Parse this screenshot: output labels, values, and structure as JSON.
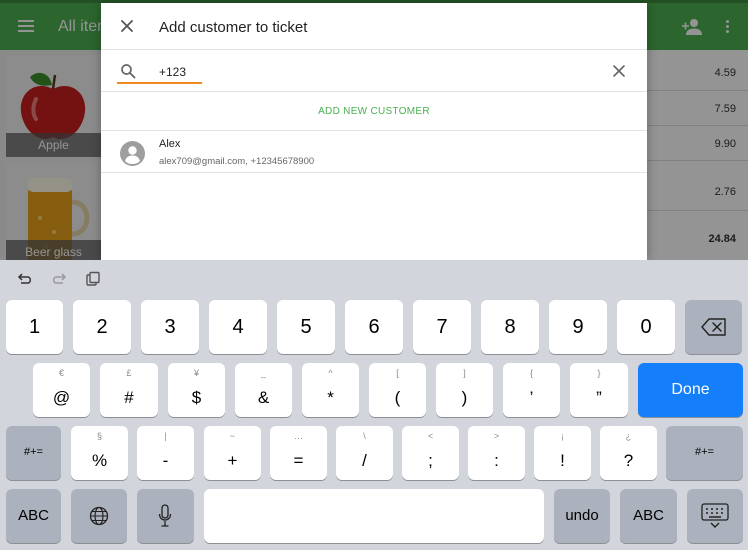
{
  "app": {
    "title": "All items",
    "tiles": [
      {
        "label": "Apple"
      },
      {
        "label": "Beer glass"
      }
    ],
    "prices": [
      "4.59",
      "7.59",
      "9.90",
      "2.76"
    ],
    "total": "24.84"
  },
  "dialog": {
    "title": "Add customer to ticket",
    "search": {
      "value": "+123",
      "placeholder": ""
    },
    "add_new_label": "ADD NEW CUSTOMER",
    "customers": [
      {
        "name": "Alex",
        "details": "alex709@gmail.com, +12345678900"
      }
    ]
  },
  "keyboard": {
    "row1": [
      "1",
      "2",
      "3",
      "4",
      "5",
      "6",
      "7",
      "8",
      "9",
      "0"
    ],
    "row2": [
      {
        "main": "@",
        "sub": "€"
      },
      {
        "main": "#",
        "sub": "£"
      },
      {
        "main": "$",
        "sub": "¥"
      },
      {
        "main": "&",
        "sub": "_"
      },
      {
        "main": "*",
        "sub": "^"
      },
      {
        "main": "(",
        "sub": "["
      },
      {
        "main": ")",
        "sub": "]"
      },
      {
        "main": "’",
        "sub": "{"
      },
      {
        "main": "”",
        "sub": "}"
      }
    ],
    "done_label": "Done",
    "row3_left": "#+=",
    "row3": [
      {
        "main": "%",
        "sub": "§"
      },
      {
        "main": "-",
        "sub": "|"
      },
      {
        "main": "+",
        "sub": "~"
      },
      {
        "main": "=",
        "sub": "…"
      },
      {
        "main": "/",
        "sub": "\\"
      },
      {
        "main": ";",
        "sub": "<"
      },
      {
        "main": ":",
        "sub": ">"
      },
      {
        "main": "!",
        "sub": "¡"
      },
      {
        "main": "?",
        "sub": "¿"
      }
    ],
    "row3_right": "#+=",
    "row4": {
      "abc_left": "ABC",
      "undo": "undo",
      "abc_right": "ABC"
    }
  },
  "colors": {
    "accent_green": "#4caf50",
    "search_underline": "#f08a24",
    "done_blue": "#157efb"
  }
}
